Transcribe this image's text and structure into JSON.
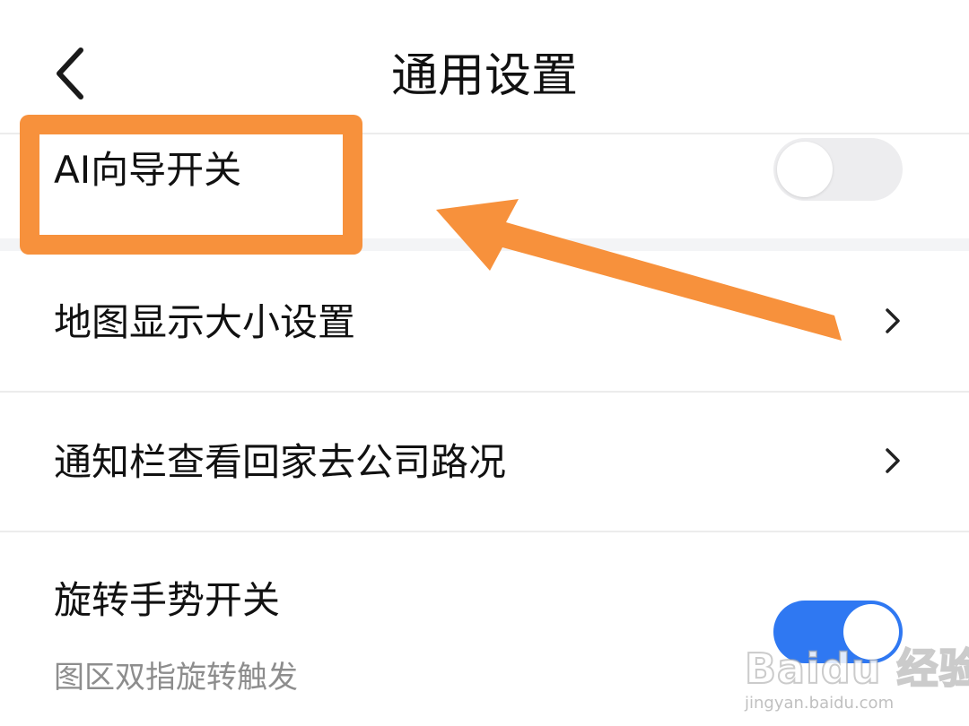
{
  "header": {
    "title": "通用设置",
    "back_icon": "chevron-left-icon"
  },
  "settings": [
    {
      "label": "AI向导开关",
      "control": "toggle",
      "enabled": false
    },
    {
      "label": "地图显示大小设置",
      "control": "chevron"
    },
    {
      "label": "通知栏查看回家去公司路况",
      "control": "chevron"
    },
    {
      "label": "旋转手势开关",
      "sublabel": "图区双指旋转触发",
      "control": "toggle",
      "enabled": true
    }
  ],
  "colors": {
    "toggle_on": "#2f78f2",
    "toggle_off": "#ededef",
    "annotation": "#f7913c"
  },
  "watermark": {
    "brand": "Baidu 经验",
    "url": "jingyan.baidu.com"
  }
}
